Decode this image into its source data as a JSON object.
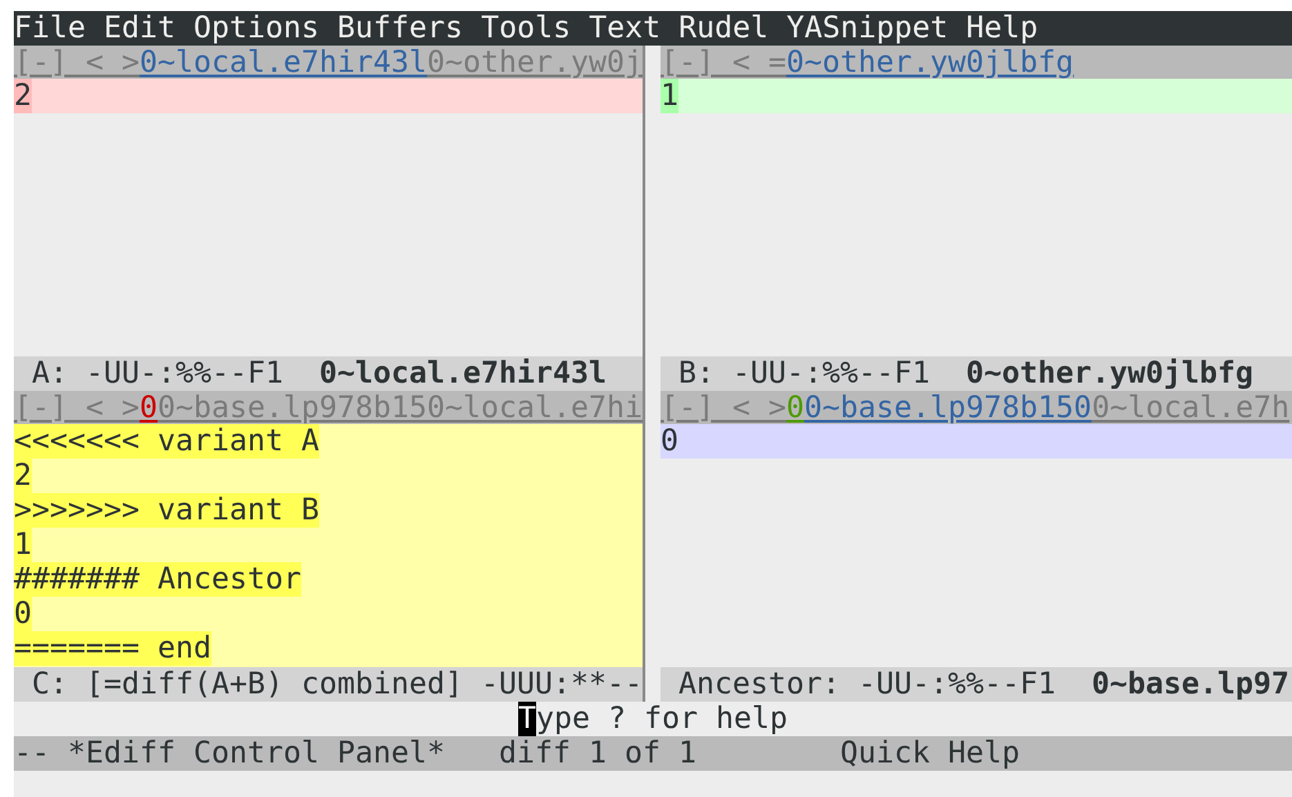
{
  "menu_bar": {
    "items": [
      "File",
      "Edit",
      "Options",
      "Buffers",
      "Tools",
      "Text",
      "Rudel",
      "YASnippet",
      "Help"
    ]
  },
  "window_rows": [
    {
      "panes": [
        {
          "header_line": [
            {
              "kind": "plain",
              "text": "[-] < >"
            },
            {
              "kind": "link",
              "text": "0~local.e7hir43l"
            },
            {
              "kind": "plain",
              "text": "0~other.yw0j"
            }
          ],
          "diff": {
            "color": "#ffd7d7",
            "lines": [
              {
                "text": "2",
                "color": "#ffbaba"
              }
            ]
          },
          "mode_line": [
            {
              "text": " A: -UU-:%%--F1  ",
              "bold": false
            },
            {
              "text": "0~local.e7hir43l",
              "bold": true
            }
          ]
        },
        {
          "header_line": [
            {
              "kind": "plain",
              "text": "[-] < ="
            },
            {
              "kind": "link",
              "text": "0~other.yw0jlbfg"
            }
          ],
          "diff": {
            "color": "#d7ffd7",
            "lines": [
              {
                "text": "1",
                "color": "#aaffaa"
              }
            ]
          },
          "mode_line": [
            {
              "text": " B: -UU-:%%--F1  ",
              "bold": false
            },
            {
              "text": "0~other.yw0jlbfg",
              "bold": true
            }
          ]
        }
      ]
    },
    {
      "panes": [
        {
          "header_line": [
            {
              "kind": "plain",
              "text": "[-] < >"
            },
            {
              "kind": "mark",
              "text": "0",
              "color": "#cc0000"
            },
            {
              "kind": "plain",
              "text": "0~base.lp978b150~local.e7hi"
            }
          ],
          "diff": {
            "color": "#ffffaa",
            "lines": [
              {
                "text": "<<<<<<< variant A",
                "color": "#ffff55"
              },
              {
                "text": "2",
                "color": "#ffff55"
              },
              {
                "text": ">>>>>>> variant B",
                "color": "#ffff55"
              },
              {
                "text": "1",
                "color": "#ffff55"
              },
              {
                "text": "####### Ancestor",
                "color": "#ffff55"
              },
              {
                "text": "0",
                "color": "#ffff55"
              },
              {
                "text": "======= end",
                "color": "#ffff55"
              }
            ]
          },
          "mode_line": [
            {
              "text": " C: [=diff(A+B) combined] -UUU:**--",
              "bold": false
            }
          ]
        },
        {
          "header_line": [
            {
              "kind": "plain",
              "text": "[-] < >"
            },
            {
              "kind": "mark",
              "text": "0",
              "color": "#4e9a06"
            },
            {
              "kind": "link",
              "text": "0~base.lp978b150"
            },
            {
              "kind": "plain",
              "text": "0~local.e7h"
            }
          ],
          "diff": {
            "color": "#d7d7ff",
            "lines": [
              {
                "text": "0",
                "color": "#d7d7ff"
              }
            ]
          },
          "mode_line": [
            {
              "text": " Ancestor: -UU-:%%--F1  ",
              "bold": false
            },
            {
              "text": "0~base.lp97",
              "bold": true
            }
          ]
        }
      ]
    }
  ],
  "help_line": {
    "cursor_char": "T",
    "text": "ype ? for help"
  },
  "control_mode_line": "-- *Ediff Control Panel*   diff 1 of 1        Quick Help"
}
